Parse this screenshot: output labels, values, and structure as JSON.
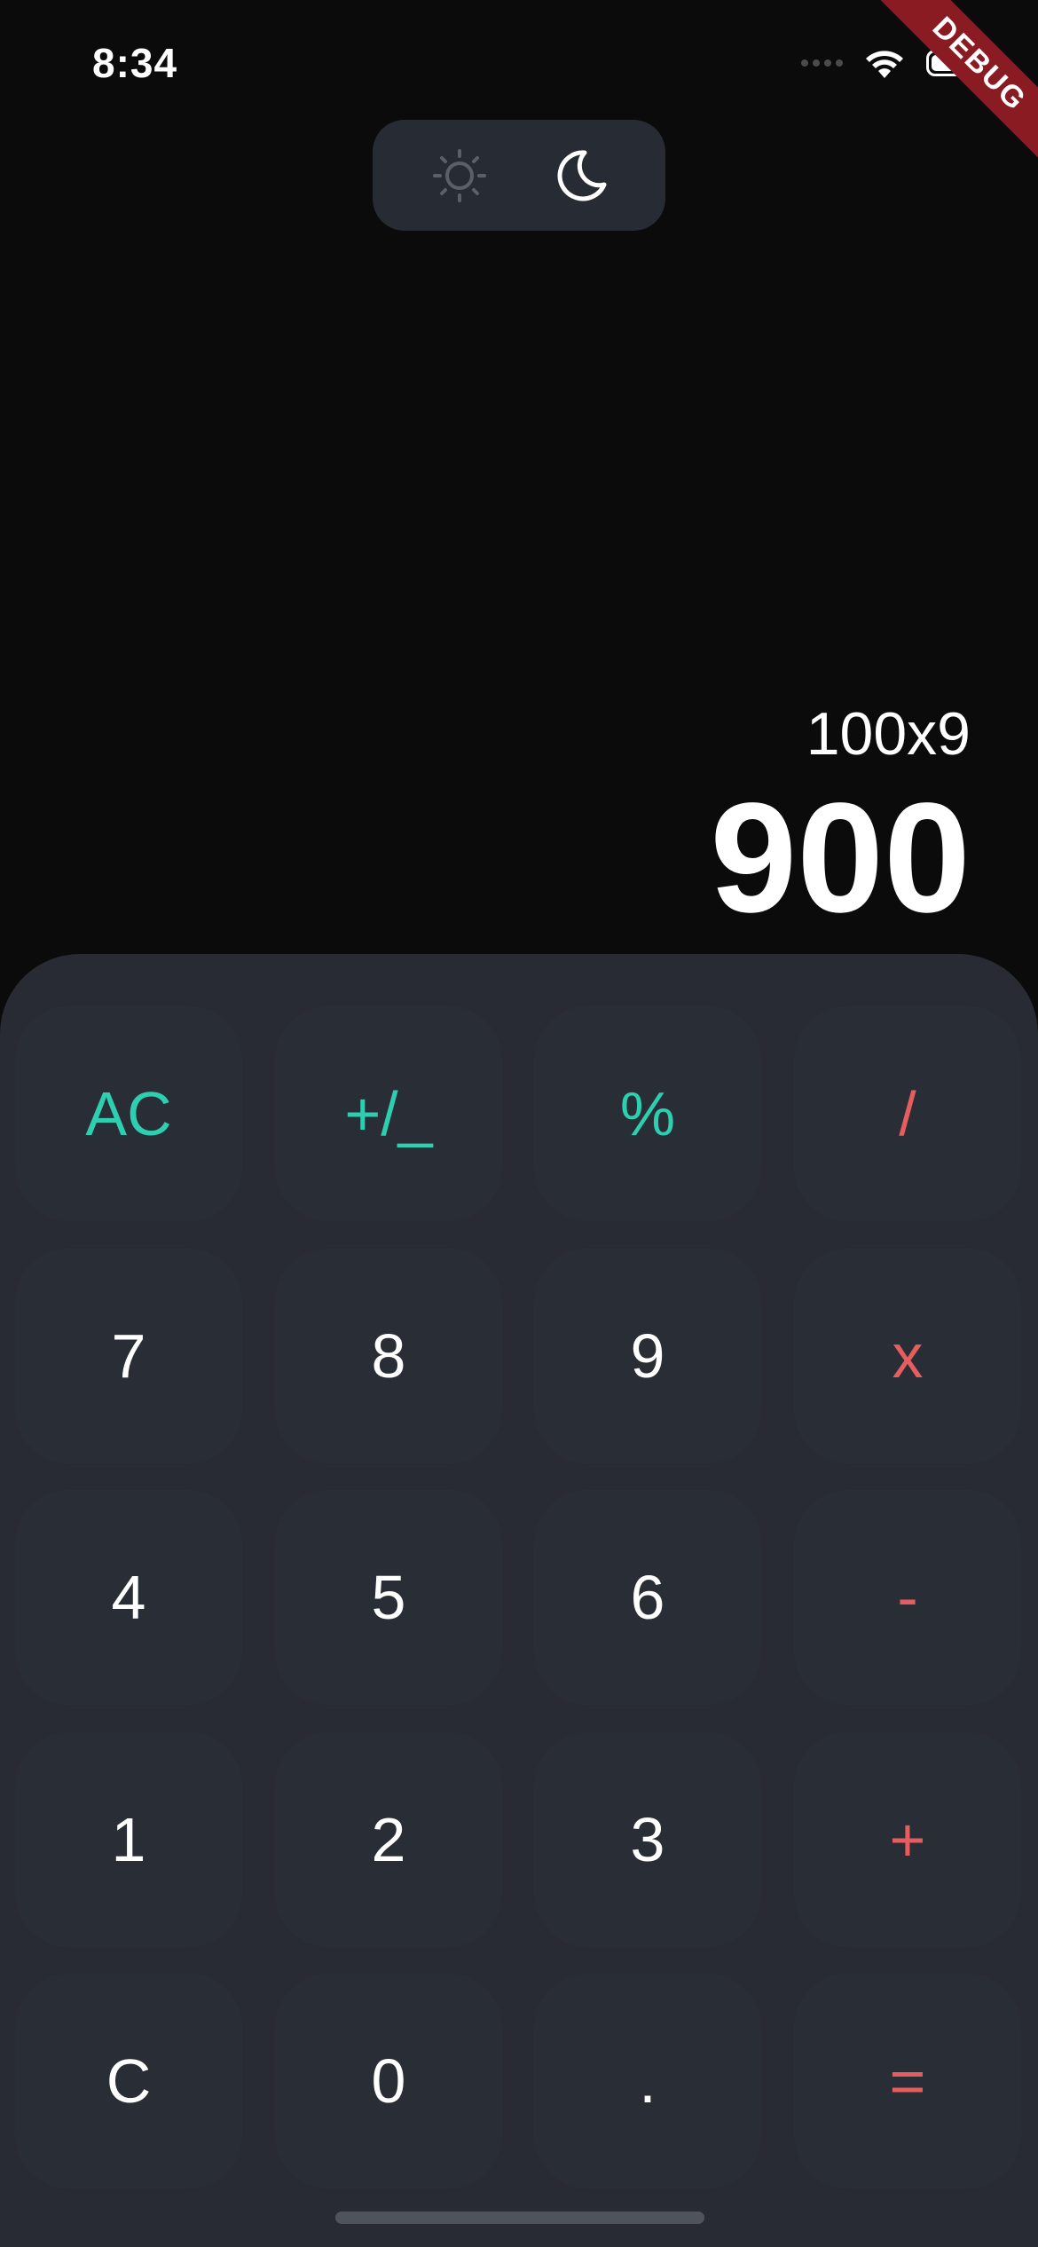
{
  "status_bar": {
    "time": "8:34"
  },
  "debug_banner": "DEBUG",
  "theme_toggle": {
    "light_icon": "sun-icon",
    "dark_icon": "moon-icon",
    "selected": "dark"
  },
  "display": {
    "expression": "100x9",
    "result": "900"
  },
  "colors": {
    "background": "#0b0b0b",
    "keypad": "#282b33",
    "key": "#292d36",
    "accent_teal": "#2ecfb1",
    "accent_red": "#e65d5f",
    "text": "#ffffff"
  },
  "keys": {
    "ac": "AC",
    "plus_minus": "+/_",
    "percent": "%",
    "divide": "/",
    "seven": "7",
    "eight": "8",
    "nine": "9",
    "multiply": "x",
    "four": "4",
    "five": "5",
    "six": "6",
    "minus": "-",
    "one": "1",
    "two": "2",
    "three": "3",
    "plus": "+",
    "clear": "C",
    "zero": "0",
    "dot": ".",
    "equals": "="
  }
}
